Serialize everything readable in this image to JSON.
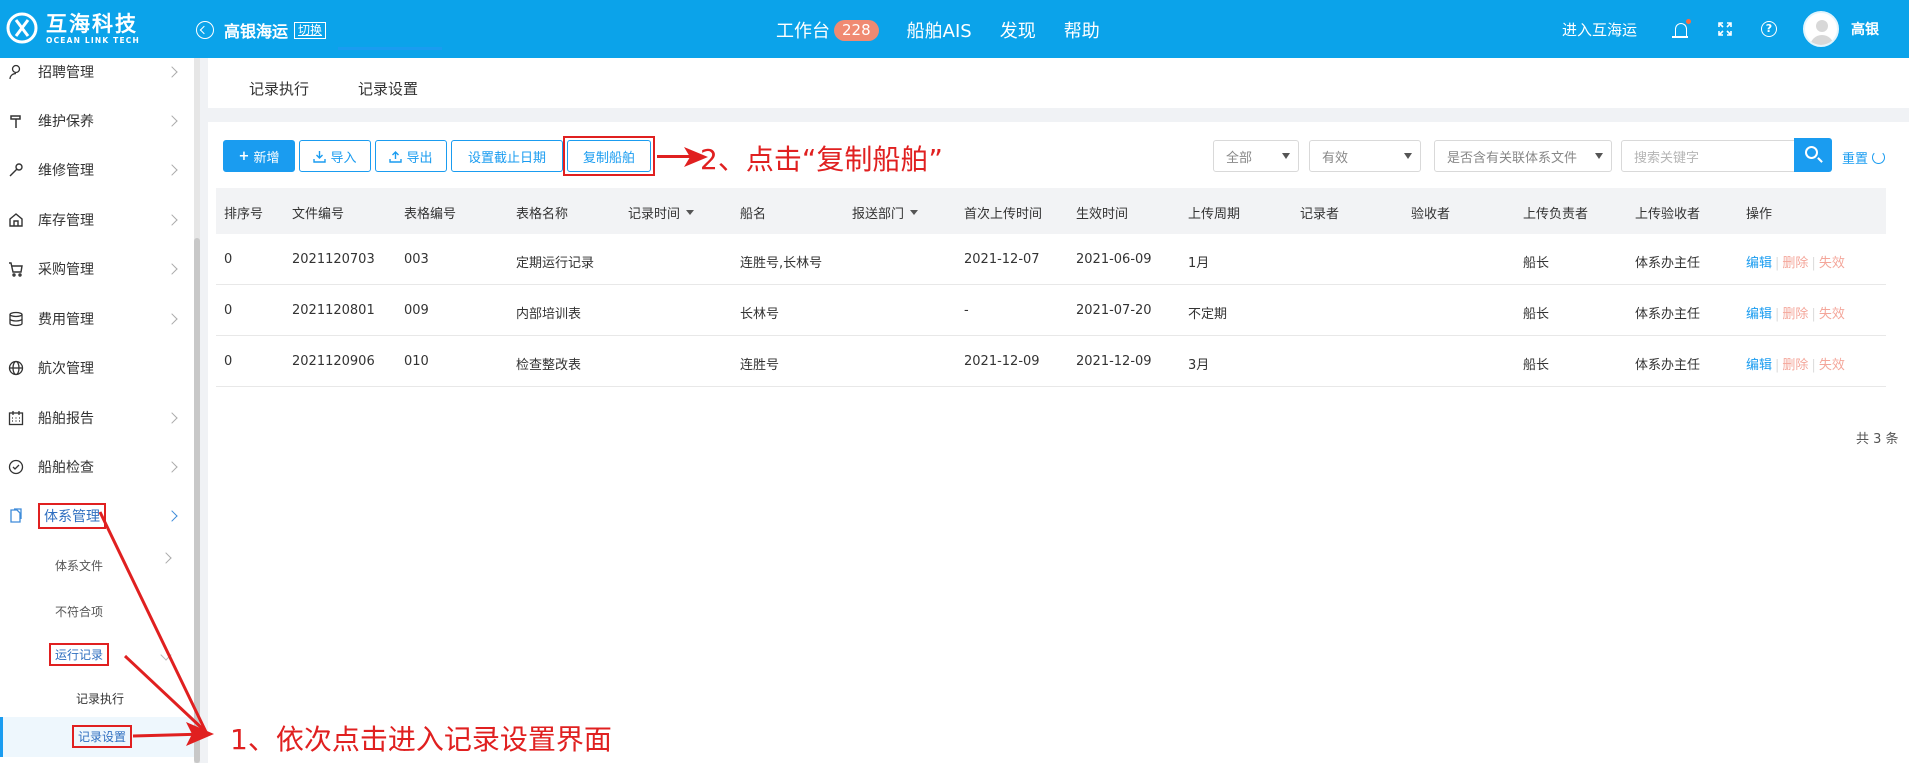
{
  "header": {
    "logo_cn": "互海科技",
    "logo_en": "OCEAN LINK TECH",
    "company": "高银海运",
    "switch_label": "切换",
    "nav": [
      {
        "label": "工作台",
        "badge": "228"
      },
      {
        "label": "船舶AIS"
      },
      {
        "label": "发现"
      },
      {
        "label": "帮助"
      }
    ],
    "enter_label": "进入互海运",
    "user_name": "高银",
    "notification_dot_color": "#ff6b3d"
  },
  "sidebar": {
    "items": [
      {
        "label": "招聘管理",
        "icon": "user-icon"
      },
      {
        "label": "维护保养",
        "icon": "hammer-icon"
      },
      {
        "label": "维修管理",
        "icon": "wrench-icon"
      },
      {
        "label": "库存管理",
        "icon": "home-icon"
      },
      {
        "label": "采购管理",
        "icon": "cart-icon"
      },
      {
        "label": "费用管理",
        "icon": "database-icon"
      },
      {
        "label": "航次管理",
        "icon": "globe-icon"
      },
      {
        "label": "船舶报告",
        "icon": "calendar-icon"
      },
      {
        "label": "船舶检查",
        "icon": "check-circle-icon"
      },
      {
        "label": "体系管理",
        "icon": "document-icon"
      }
    ],
    "sub_items": [
      "体系文件",
      "不符合项",
      "运行记录"
    ],
    "sub_sub_items": [
      "记录执行",
      "记录设置"
    ]
  },
  "tabs": [
    "记录执行",
    "记录设置"
  ],
  "toolbar": {
    "add": "新增",
    "import": "导入",
    "export": "导出",
    "deadline": "设置截止日期",
    "copy_ship": "复制船舶"
  },
  "filters": {
    "scope": "全部",
    "status": "有效",
    "related": "是否含有关联体系文件",
    "search_placeholder": "搜索关键字",
    "reset": "重置"
  },
  "annotations": {
    "step1": "1、依次点击进入记录设置界面",
    "step2": "2、点击“复制船舶”"
  },
  "table": {
    "columns": [
      "排序号",
      "文件编号",
      "表格编号",
      "表格名称",
      "记录时间",
      "船名",
      "报送部门",
      "首次上传时间",
      "生效时间",
      "上传周期",
      "记录者",
      "验收者",
      "上传负责者",
      "上传验收者",
      "操作"
    ],
    "rows": [
      [
        "0",
        "2021120703",
        "003",
        "定期运行记录",
        "",
        "连胜号,长林号",
        "",
        "2021-12-07",
        "2021-06-09",
        "1月",
        "",
        "",
        "船长",
        "体系办主任"
      ],
      [
        "0",
        "2021120801",
        "009",
        "内部培训表",
        "",
        "长林号",
        "",
        "-",
        "2021-07-20",
        "不定期",
        "",
        "",
        "船长",
        "体系办主任"
      ],
      [
        "0",
        "2021120906",
        "010",
        "检查整改表",
        "",
        "连胜号",
        "",
        "2021-12-09",
        "2021-12-09",
        "3月",
        "",
        "",
        "船长",
        "体系办主任"
      ]
    ],
    "ops": {
      "edit": "编辑",
      "delete": "删除",
      "invalidate": "失效"
    },
    "total": "共 3 条"
  },
  "colors": {
    "header_bg": "#0ba3ea",
    "primary": "#1a9cf0",
    "annotation": "#e02020",
    "badge": "#f08a72"
  }
}
